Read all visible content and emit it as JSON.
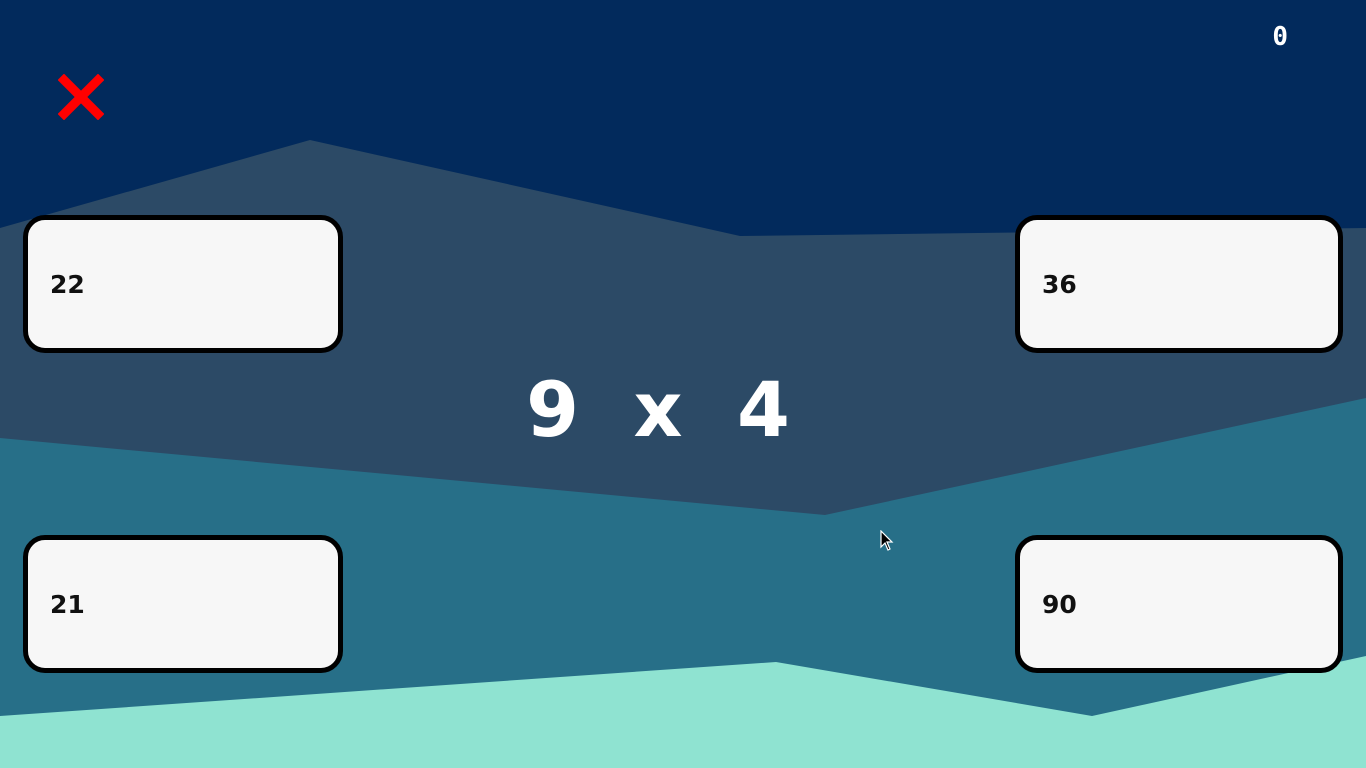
{
  "score": "0",
  "question": {
    "left": "9",
    "operator": "x",
    "right": "4"
  },
  "answers": {
    "top_left": "22",
    "top_right": "36",
    "bottom_left": "21",
    "bottom_right": "90"
  },
  "icons": {
    "close": "close-icon",
    "cursor": "mouse-cursor"
  },
  "colors": {
    "sky": "#022a5c",
    "mountain_far": "#2c4a66",
    "mountain_mid": "#276f88",
    "ground": "#8fe3d1",
    "close_icon": "#ff0000",
    "card_bg": "#f7f7f7",
    "card_border": "#000000",
    "text_light": "#ffffff"
  }
}
